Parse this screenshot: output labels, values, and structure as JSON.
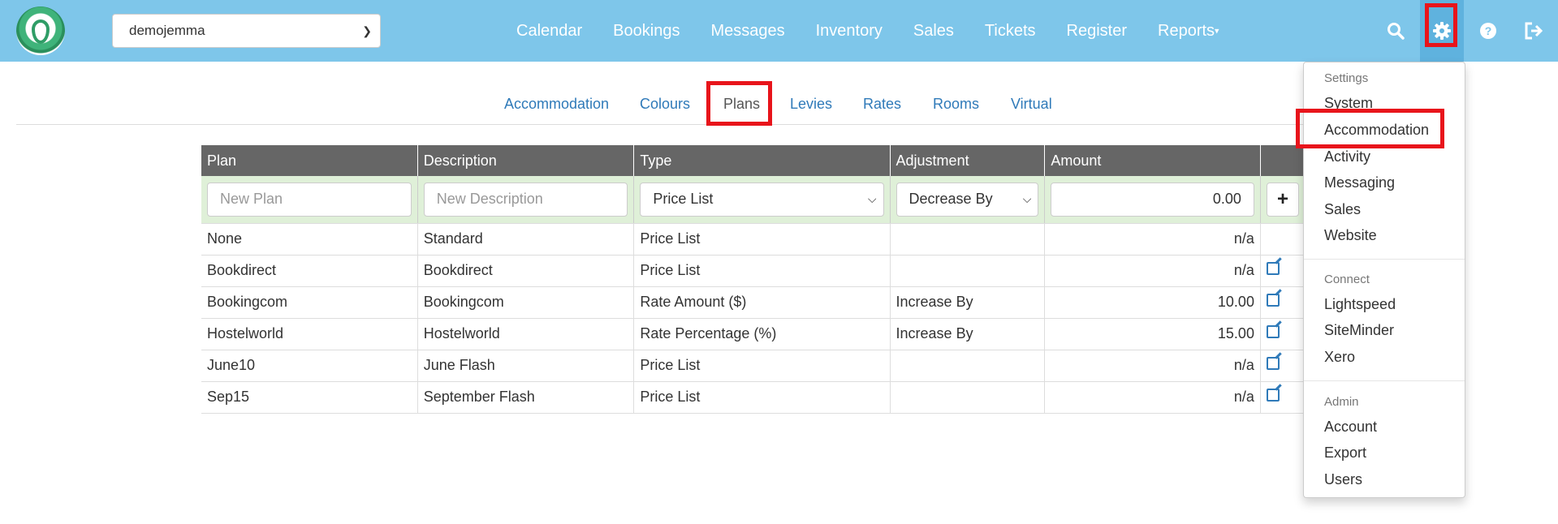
{
  "app": {
    "property_select": "demojemma"
  },
  "nav": {
    "items": [
      "Calendar",
      "Bookings",
      "Messages",
      "Inventory",
      "Sales",
      "Tickets",
      "Register",
      "Reports"
    ]
  },
  "toolbar_icons": [
    "search-icon",
    "gear-icon",
    "help-icon",
    "logout-icon"
  ],
  "subnav": {
    "items": [
      "Accommodation",
      "Colours",
      "Plans",
      "Levies",
      "Rates",
      "Rooms",
      "Virtual"
    ],
    "active": "Plans"
  },
  "table": {
    "headers": [
      "Plan",
      "Description",
      "Type",
      "Adjustment",
      "Amount",
      ""
    ],
    "new_row": {
      "plan_placeholder": "New Plan",
      "description_placeholder": "New Description",
      "type_value": "Price List",
      "adjustment_value": "Decrease By",
      "amount_value": "0.00",
      "add_label": "+"
    },
    "rows": [
      {
        "plan": "None",
        "description": "Standard",
        "type": "Price List",
        "adjustment": "",
        "amount": "n/a"
      },
      {
        "plan": "Bookdirect",
        "description": "Bookdirect",
        "type": "Price List",
        "adjustment": "",
        "amount": "n/a"
      },
      {
        "plan": "Bookingcom",
        "description": "Bookingcom",
        "type": "Rate Amount ($)",
        "adjustment": "Increase By",
        "amount": "10.00"
      },
      {
        "plan": "Hostelworld",
        "description": "Hostelworld",
        "type": "Rate Percentage (%)",
        "adjustment": "Increase By",
        "amount": "15.00"
      },
      {
        "plan": "June10",
        "description": "June Flash",
        "type": "Price List",
        "adjustment": "",
        "amount": "n/a"
      },
      {
        "plan": "Sep15",
        "description": "September Flash",
        "type": "Price List",
        "adjustment": "",
        "amount": "n/a"
      }
    ]
  },
  "settings_menu": {
    "settings_header": "Settings",
    "settings_items": [
      "System",
      "Accommodation",
      "Activity",
      "Messaging",
      "Sales",
      "Website"
    ],
    "connect_header": "Connect",
    "connect_items": [
      "Lightspeed",
      "SiteMinder",
      "Xero"
    ],
    "admin_header": "Admin",
    "admin_items": [
      "Account",
      "Export",
      "Users"
    ]
  },
  "colors": {
    "topbar": "#7ec6ea",
    "highlight": "#e8141b",
    "link": "#2f7ab9",
    "header_row": "#666666",
    "new_row": "#dff0d8"
  }
}
